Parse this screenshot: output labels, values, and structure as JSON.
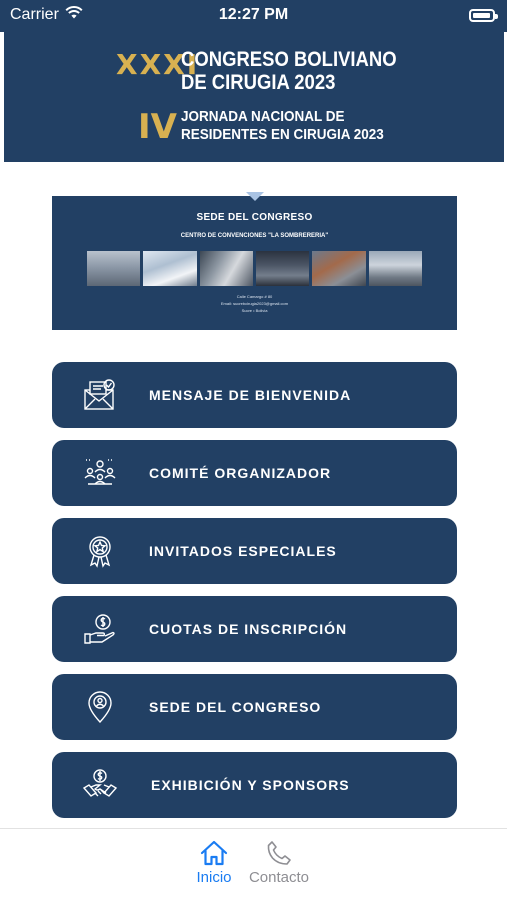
{
  "status_bar": {
    "carrier": "Carrier",
    "time": "12:27 PM",
    "battery_level": 0.95
  },
  "header": {
    "roman_congress": "XXXI",
    "congress_title": "CONGRESO BOLIVIANO DE CIRUGIA 2023",
    "roman_jornada": "IV",
    "jornada_title": "JORNADA NACIONAL DE RESIDENTES EN CIRUGIA 2023"
  },
  "sede_banner": {
    "title": "SEDE DEL CONGRESO",
    "venue": "CENTRO DE CONVENCIONES \"LA SOMBRERERIA\"",
    "info_lines": [
      "Calle Camargo # 80",
      "Email: sucrebcirugia2023@gmail.com",
      "Sucre • Bolivia"
    ]
  },
  "menu": [
    {
      "label": "MENSAJE DE BIENVENIDA",
      "icon": "envelope-message-icon"
    },
    {
      "label": "COMITÉ ORGANIZADOR",
      "icon": "committee-icon"
    },
    {
      "label": "INVITADOS ESPECIALES",
      "icon": "award-badge-icon"
    },
    {
      "label": "CUOTAS DE INSCRIPCIÓN",
      "icon": "money-hand-icon"
    },
    {
      "label": "SEDE DEL CONGRESO",
      "icon": "location-pin-icon"
    },
    {
      "label": "EXHIBICIÓN Y SPONSORS",
      "icon": "handshake-icon"
    }
  ],
  "tab_bar": {
    "tabs": [
      {
        "label": "Inicio",
        "icon": "home-icon",
        "active": true
      },
      {
        "label": "Contacto",
        "icon": "phone-icon",
        "active": false
      }
    ]
  },
  "colors": {
    "primary": "#224064",
    "accent_gold": "#d8b151",
    "tab_active": "#1a7cf2",
    "tab_inactive": "#8e8e93"
  }
}
